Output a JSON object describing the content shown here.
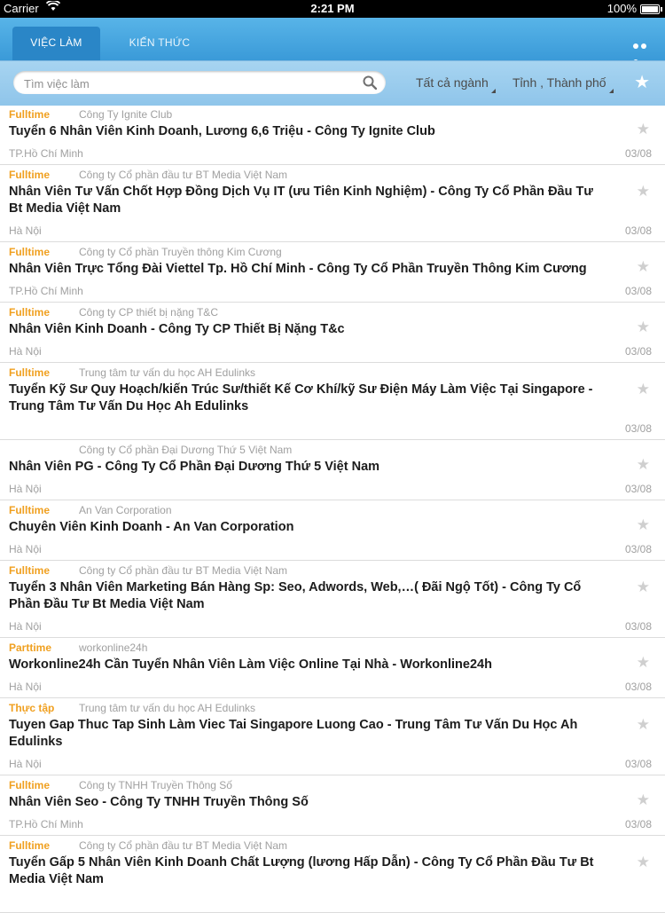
{
  "status_bar": {
    "carrier": "Carrier",
    "time": "2:21 PM",
    "battery": "100%"
  },
  "tabs": [
    {
      "label": "VIỆC LÀM"
    },
    {
      "label": "KIẾN THỨC"
    }
  ],
  "filter": {
    "search_placeholder": "Tìm việc làm",
    "industry": "Tất cả ngành",
    "city": "Tỉnh , Thành phố"
  },
  "jobs": [
    {
      "type": "Fulltime",
      "company": "Công Ty Ignite Club",
      "title": "Tuyển 6 Nhân Viên Kinh Doanh, Lương 6,6 Triệu - Công Ty Ignite Club",
      "location": "TP.Hồ Chí Minh",
      "date": "03/08"
    },
    {
      "type": "Fulltime",
      "company": "Công ty Cổ phần đầu tư BT Media Việt Nam",
      "title": "Nhân Viên Tư Vấn Chốt Hợp Đồng Dịch Vụ IT (ưu Tiên Kinh Nghiệm) - Công Ty Cổ Phần Đầu Tư Bt Media Việt Nam",
      "location": "Hà Nội",
      "date": "03/08"
    },
    {
      "type": "Fulltime",
      "company": "Công ty Cổ phần Truyền thông Kim Cương",
      "title": "Nhân Viên Trực Tổng Đài Viettel Tp. Hồ Chí Minh - Công Ty Cổ Phần Truyền Thông Kim Cương",
      "location": "TP.Hồ Chí Minh",
      "date": "03/08"
    },
    {
      "type": "Fulltime",
      "company": "Công ty CP thiết bị nặng T&C",
      "title": "Nhân Viên Kinh Doanh - Công Ty CP Thiết Bị Nặng T&c",
      "location": "Hà Nội",
      "date": "03/08"
    },
    {
      "type": "Fulltime",
      "company": "Trung tâm tư vấn du học AH Edulinks",
      "title": "Tuyển Kỹ Sư Quy Hoạch/kiến Trúc Sư/thiết Kế Cơ Khí/kỹ Sư Điện Máy Làm Việc Tại Singapore - Trung Tâm Tư Vấn Du Học Ah Edulinks",
      "location": "",
      "date": "03/08"
    },
    {
      "type": "",
      "company": "Công ty Cổ phần Đại Dương Thứ 5 Việt Nam",
      "title": "Nhân Viên PG - Công Ty Cổ Phần Đại Dương Thứ 5 Việt Nam",
      "location": "Hà Nội",
      "date": "03/08"
    },
    {
      "type": "Fulltime",
      "company": "An Van Corporation",
      "title": "Chuyên Viên Kinh Doanh - An Van Corporation",
      "location": "Hà Nội",
      "date": "03/08"
    },
    {
      "type": "Fulltime",
      "company": "Công ty Cổ phần đầu tư BT Media Việt Nam",
      "title": "Tuyển 3 Nhân Viên Marketing Bán Hàng Sp: Seo, Adwords, Web,…( Đãi Ngộ Tốt) - Công Ty Cổ Phần Đầu Tư Bt Media Việt Nam",
      "location": "Hà Nội",
      "date": "03/08"
    },
    {
      "type": "Parttime",
      "company": "workonline24h",
      "title": "Workonline24h Cần Tuyển Nhân Viên Làm Việc Online Tại Nhà - Workonline24h",
      "location": "Hà Nội",
      "date": "03/08"
    },
    {
      "type": "Thực tập",
      "company": "Trung tâm tư vấn du học AH Edulinks",
      "title": "Tuyen Gap Thuc Tap Sinh Làm Viec Tai Singapore Luong Cao - Trung Tâm Tư Vấn Du Học Ah Edulinks",
      "location": "Hà Nội",
      "date": "03/08"
    },
    {
      "type": "Fulltime",
      "company": "Công ty TNHH Truyền Thông Số",
      "title": "Nhân Viên Seo - Công Ty TNHH Truyền Thông Số",
      "location": "TP.Hồ Chí Minh",
      "date": "03/08"
    },
    {
      "type": "Fulltime",
      "company": "Công ty Cổ phần đầu tư BT Media Việt Nam",
      "title": "Tuyển Gấp 5 Nhân Viên Kinh Doanh Chất Lượng (lương Hấp Dẫn) - Công Ty Cổ Phần Đầu Tư Bt Media Việt Nam",
      "location": "",
      "date": ""
    }
  ]
}
